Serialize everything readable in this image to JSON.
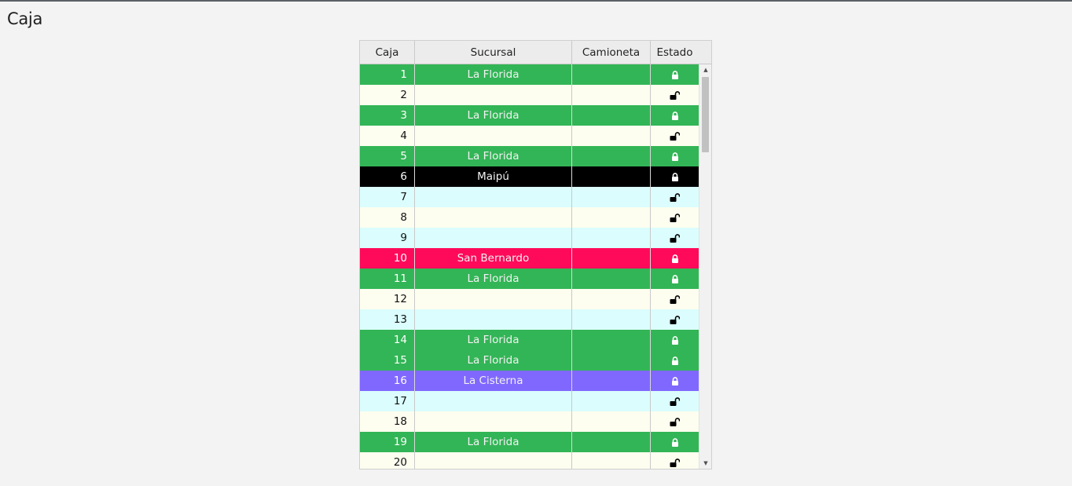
{
  "page": {
    "title": "Caja"
  },
  "columns": {
    "caja": "Caja",
    "sucursal": "Sucursal",
    "camioneta": "Camioneta",
    "estado": "Estado"
  },
  "colors": {
    "la_florida": "#32b556",
    "maipu": "#000000",
    "san_bernardo": "#ff0a5a",
    "la_cisterna": "#8068ff",
    "free_even": "#fdfeef",
    "free_odd": "#dbfdfd"
  },
  "rows": [
    {
      "caja": "1",
      "sucursal": "La Florida",
      "camioneta": "",
      "locked": true,
      "color": "#32b556"
    },
    {
      "caja": "2",
      "sucursal": "",
      "camioneta": "",
      "locked": false,
      "color": ""
    },
    {
      "caja": "3",
      "sucursal": "La Florida",
      "camioneta": "",
      "locked": true,
      "color": "#32b556"
    },
    {
      "caja": "4",
      "sucursal": "",
      "camioneta": "",
      "locked": false,
      "color": ""
    },
    {
      "caja": "5",
      "sucursal": "La Florida",
      "camioneta": "",
      "locked": true,
      "color": "#32b556"
    },
    {
      "caja": "6",
      "sucursal": "Maipú",
      "camioneta": "",
      "locked": true,
      "color": "#000000"
    },
    {
      "caja": "7",
      "sucursal": "",
      "camioneta": "",
      "locked": false,
      "color": ""
    },
    {
      "caja": "8",
      "sucursal": "",
      "camioneta": "",
      "locked": false,
      "color": ""
    },
    {
      "caja": "9",
      "sucursal": "",
      "camioneta": "",
      "locked": false,
      "color": ""
    },
    {
      "caja": "10",
      "sucursal": "San Bernardo",
      "camioneta": "",
      "locked": true,
      "color": "#ff0a5a"
    },
    {
      "caja": "11",
      "sucursal": "La Florida",
      "camioneta": "",
      "locked": true,
      "color": "#32b556"
    },
    {
      "caja": "12",
      "sucursal": "",
      "camioneta": "",
      "locked": false,
      "color": ""
    },
    {
      "caja": "13",
      "sucursal": "",
      "camioneta": "",
      "locked": false,
      "color": ""
    },
    {
      "caja": "14",
      "sucursal": "La Florida",
      "camioneta": "",
      "locked": true,
      "color": "#32b556"
    },
    {
      "caja": "15",
      "sucursal": "La Florida",
      "camioneta": "",
      "locked": true,
      "color": "#32b556"
    },
    {
      "caja": "16",
      "sucursal": "La Cisterna",
      "camioneta": "",
      "locked": true,
      "color": "#8068ff"
    },
    {
      "caja": "17",
      "sucursal": "",
      "camioneta": "",
      "locked": false,
      "color": ""
    },
    {
      "caja": "18",
      "sucursal": "",
      "camioneta": "",
      "locked": false,
      "color": ""
    },
    {
      "caja": "19",
      "sucursal": "La Florida",
      "camioneta": "",
      "locked": true,
      "color": "#32b556"
    },
    {
      "caja": "20",
      "sucursal": "",
      "camioneta": "",
      "locked": false,
      "color": ""
    }
  ],
  "icons": {
    "locked": "lock-icon",
    "unlocked": "unlock-icon",
    "scroll_up": "triangle-up-icon",
    "scroll_down": "triangle-down-icon"
  }
}
